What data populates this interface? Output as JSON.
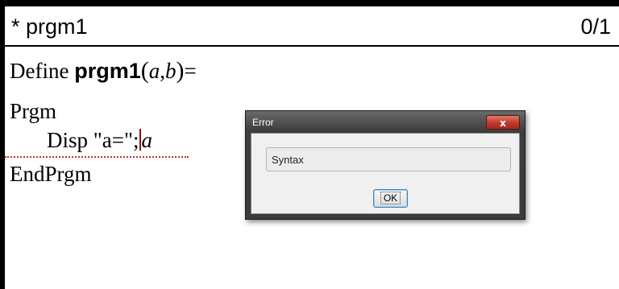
{
  "titlebar": {
    "name": "* prgm1",
    "page": "0/1"
  },
  "editor": {
    "line1": {
      "keyword": "Define ",
      "name": "prgm1",
      "open": "(",
      "arg1": "a",
      "comma": ",",
      "arg2": "b",
      "close": ")",
      "eq": "="
    },
    "line2": "Prgm",
    "line3": {
      "text": "Disp \"a=\";",
      "var": "a"
    },
    "line4": "EndPrgm"
  },
  "dialog": {
    "title": "Error",
    "close": "x",
    "message": "Syntax",
    "ok": "OK"
  }
}
